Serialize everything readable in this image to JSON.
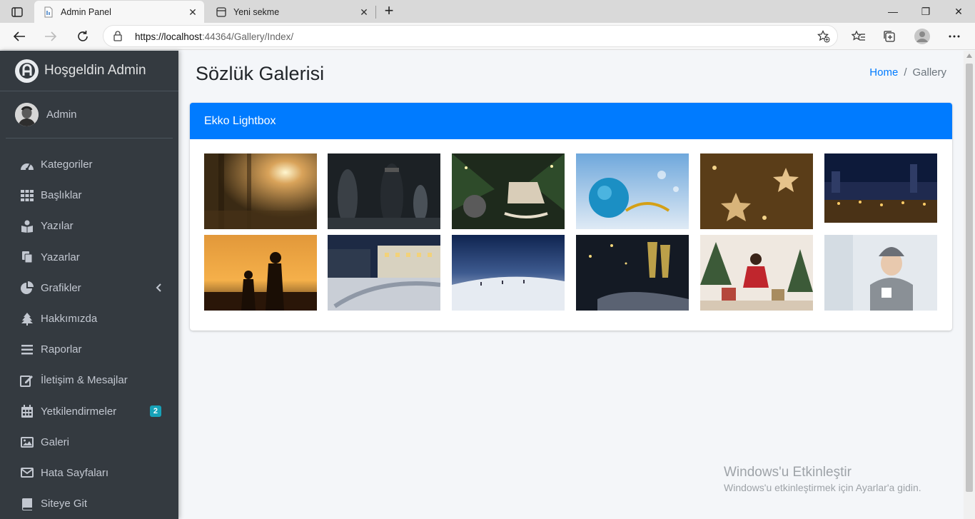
{
  "browser": {
    "tabs": [
      {
        "title": "Admin Panel",
        "active": true
      },
      {
        "title": "Yeni sekme",
        "active": false
      }
    ],
    "url_host": "https://localhost",
    "url_rest": ":44364/Gallery/Index/",
    "window_controls": [
      "minimize-icon",
      "restore-icon",
      "close-icon"
    ]
  },
  "sidebar": {
    "brand": "Hoşgeldin Admin",
    "user": "Admin",
    "items": [
      {
        "label": "Kategoriler",
        "icon": "tachometer-icon"
      },
      {
        "label": "Başlıklar",
        "icon": "grid-icon"
      },
      {
        "label": "Yazılar",
        "icon": "book-reader-icon"
      },
      {
        "label": "Yazarlar",
        "icon": "copy-icon"
      },
      {
        "label": "Grafikler",
        "icon": "pie-chart-icon"
      },
      {
        "label": "Hakkımızda",
        "icon": "tree-icon"
      },
      {
        "label": "Raporlar",
        "icon": "bars-icon"
      },
      {
        "label": "İletişim & Mesajlar",
        "icon": "edit-icon"
      },
      {
        "label": "Yetkilendirmeler",
        "icon": "calendar-icon",
        "badge": "2"
      },
      {
        "label": "Galeri",
        "icon": "image-icon"
      },
      {
        "label": "Hata Sayfaları",
        "icon": "envelope-icon"
      },
      {
        "label": "Siteye Git",
        "icon": "book-icon"
      }
    ]
  },
  "content": {
    "title": "Sözlük Galerisi",
    "breadcrumb": {
      "home": "Home",
      "sep": "/",
      "current": "Gallery"
    },
    "card_title": "Ekko Lightbox",
    "images": [
      {
        "name": "forest-sunlight"
      },
      {
        "name": "chess-pieces"
      },
      {
        "name": "christmas-ornament-horse"
      },
      {
        "name": "blue-bauble"
      },
      {
        "name": "gold-stars"
      },
      {
        "name": "night-city-market"
      },
      {
        "name": "sunset-silhouette"
      },
      {
        "name": "snowy-hotel-night"
      },
      {
        "name": "snowy-landscape"
      },
      {
        "name": "champagne-glasses"
      },
      {
        "name": "christmas-girl"
      },
      {
        "name": "winter-woman"
      }
    ]
  },
  "watermark": {
    "title": "Windows'u Etkinleştir",
    "subtitle": "Windows'u etkinleştirmek için Ayarlar'a gidin."
  },
  "colors": {
    "accent": "#007bff",
    "sidebar": "#343a40",
    "badge": "#17a2b8"
  }
}
